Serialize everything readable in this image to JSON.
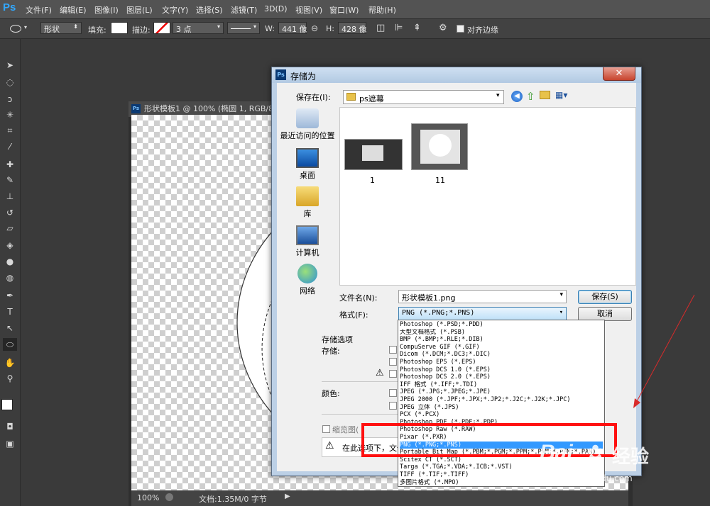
{
  "app": {
    "logo": "Ps"
  },
  "menu": [
    "文件(F)",
    "编辑(E)",
    "图像(I)",
    "图层(L)",
    "文字(Y)",
    "选择(S)",
    "滤镜(T)",
    "3D(D)",
    "视图(V)",
    "窗口(W)",
    "帮助(H)"
  ],
  "options": {
    "shape_mode": "形状",
    "fill_label": "填充:",
    "stroke_label": "描边:",
    "stroke_size": "3 点",
    "w_label": "W:",
    "w_value": "441 像",
    "h_label": "H:",
    "h_value": "428 像",
    "align_edges": "对齐边缘"
  },
  "document": {
    "title": "形状模板1 @ 100% (椭圆 1, RGB/8) *",
    "zoom": "100%",
    "doc_info": "文档:1.35M/0 字节"
  },
  "dialog": {
    "title": "存储为",
    "save_in_label": "保存在(I):",
    "save_in_value": "ps遮幕",
    "places": [
      "最近访问的位置",
      "桌面",
      "库",
      "计算机",
      "网络"
    ],
    "files": [
      {
        "name": "1"
      },
      {
        "name": "11"
      }
    ],
    "filename_label": "文件名(N):",
    "filename_value": "形状模板1.png",
    "format_label": "格式(F):",
    "format_value": "PNG (*.PNG;*.PNS)",
    "save_button": "保存(S)",
    "cancel_button": "取消",
    "save_options_label": "存储选项",
    "store_label": "存储:",
    "color_label": "颜色:",
    "thumbnail_label": "缩览图(",
    "warning_text": "在此选项下，文件",
    "format_options": [
      "Photoshop (*.PSD;*.PDD)",
      "大型文档格式 (*.PSB)",
      "BMP (*.BMP;*.RLE;*.DIB)",
      "CompuServe GIF (*.GIF)",
      "Dicom (*.DCM;*.DC3;*.DIC)",
      "Photoshop EPS (*.EPS)",
      "Photoshop DCS 1.0 (*.EPS)",
      "Photoshop DCS 2.0 (*.EPS)",
      "IFF 格式 (*.IFF;*.TDI)",
      "JPEG (*.JPG;*.JPEG;*.JPE)",
      "JPEG 2000 (*.JPF;*.JPX;*.JP2;*.J2C;*.J2K;*.JPC)",
      "JPEG 立体 (*.JPS)",
      "PCX (*.PCX)",
      "Photoshop PDF (*.PDF;*.PDP)",
      "Photoshop Raw (*.RAW)",
      "Pixar (*.PXR)",
      "PNG (*.PNG;*.PNS)",
      "Portable Bit Map (*.PBM;*.PGM;*.PPM;*.PNM;*.PFM;*.PAM)",
      "Scitex CT (*.SCT)",
      "Targa (*.TGA;*.VDA;*.ICB;*.VST)",
      "TIFF (*.TIF;*.TIFF)",
      "多图片格式 (*.MPO)"
    ],
    "selected_format_index": 16
  },
  "watermark": {
    "brand": "Bai",
    "brand_cn": "经验",
    "url": "jingyan.baidu.com"
  },
  "colors": {
    "highlight": "#ff1010",
    "selection": "#3399ff",
    "ps_blue": "#31a8ff"
  }
}
